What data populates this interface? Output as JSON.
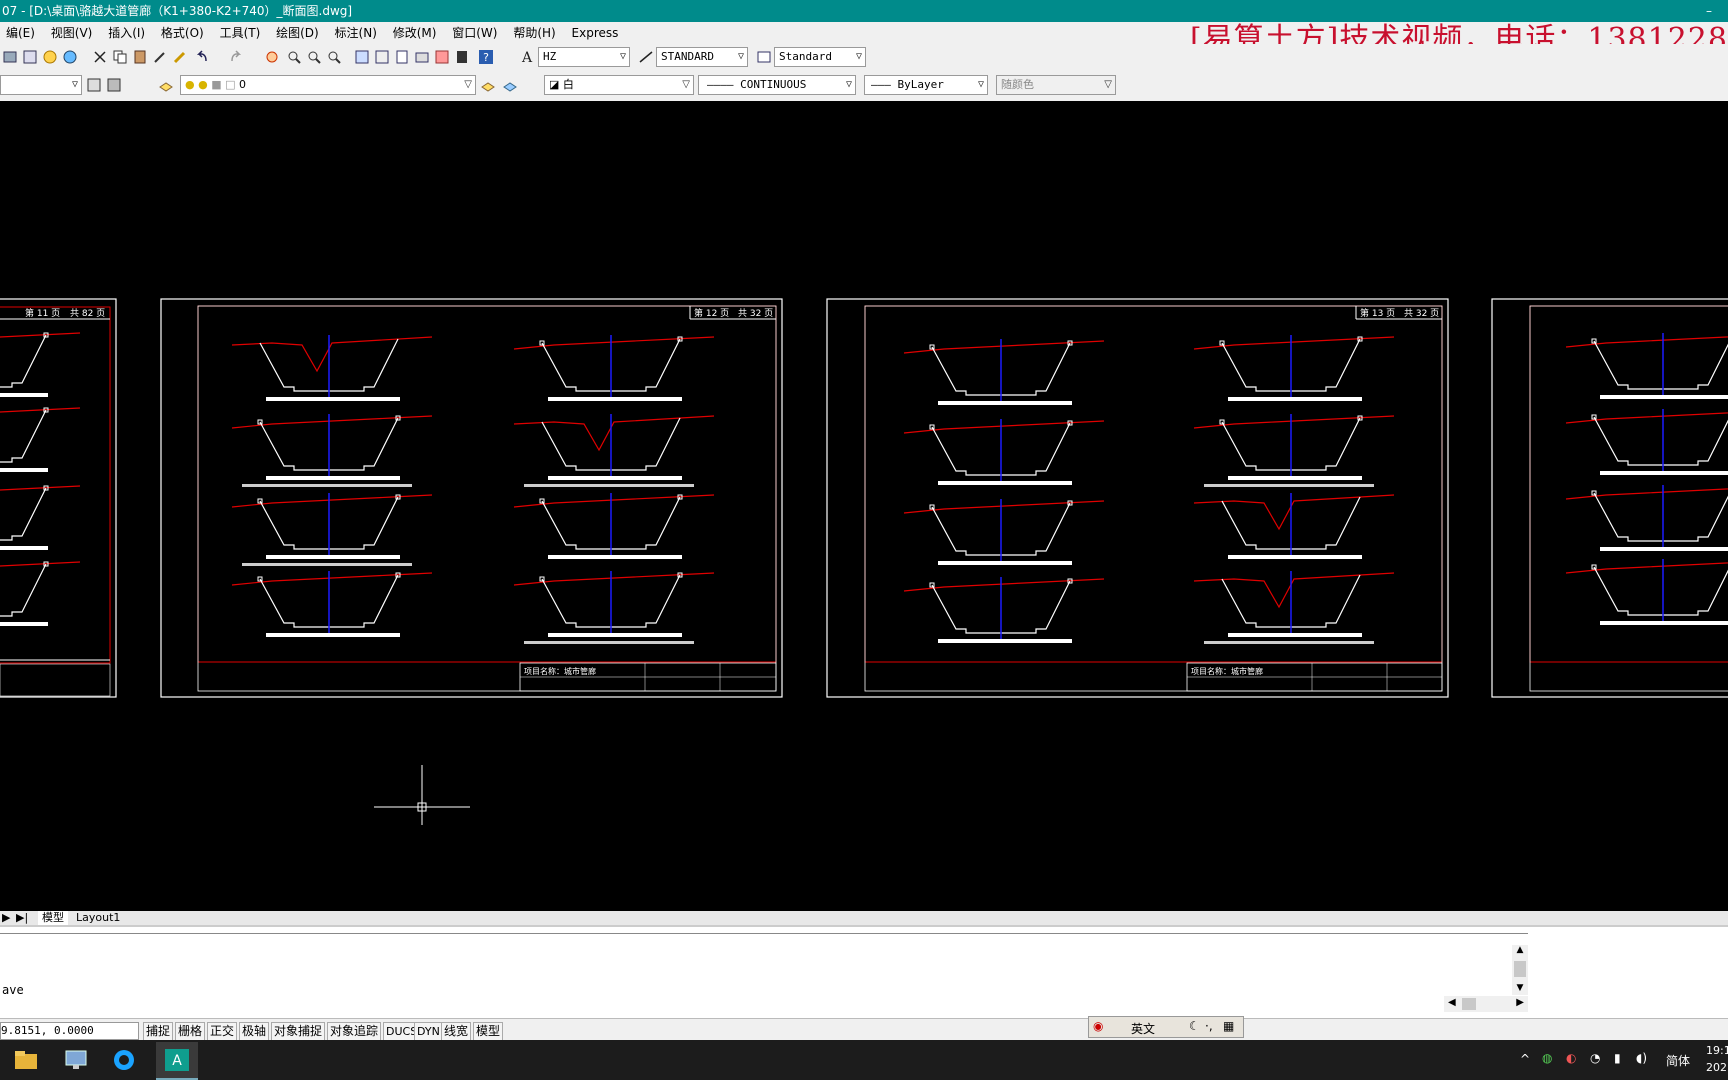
{
  "window": {
    "title": "07 - [D:\\桌面\\骆越大道管廊（K1+380-K2+740）_断面图.dwg]",
    "minimize": "–"
  },
  "menu": [
    "编(E)",
    "视图(V)",
    "插入(I)",
    "格式(O)",
    "工具(T)",
    "绘图(D)",
    "标注(N)",
    "修改(M)",
    "窗口(W)",
    "帮助(H)",
    "Express"
  ],
  "promo": "[易算土方]技术视频，电话：1381228",
  "toolbar": {
    "text_style": "HZ",
    "dim_style": "STANDARD",
    "table_style": "Standard",
    "layer": "0",
    "color": "白",
    "linetype": "CONTINUOUS",
    "lineweight": "ByLayer",
    "plot_style": "随颜色"
  },
  "sheets": [
    {
      "page": "第 11 页",
      "total": "共 82 页"
    },
    {
      "page": "第 12 页",
      "total": "共 32 页"
    },
    {
      "page": "第 13 页",
      "total": "共 32 页"
    }
  ],
  "title_block": {
    "project": "项目名称：城市管廊"
  },
  "layout_tabs": {
    "model": "模型",
    "layout1": "Layout1"
  },
  "command": {
    "last_line": "ave"
  },
  "status": {
    "coords": "9.8151, 0.0000",
    "toggles": [
      "捕捉",
      "栅格",
      "正交",
      "极轴",
      "对象捕捉",
      "对象追踪",
      "DUCS",
      "DYN",
      "线宽",
      "模型"
    ]
  },
  "ime": {
    "lang": "英文"
  },
  "tray": {
    "lang": "简体",
    "time": "19:1",
    "date": "202"
  }
}
